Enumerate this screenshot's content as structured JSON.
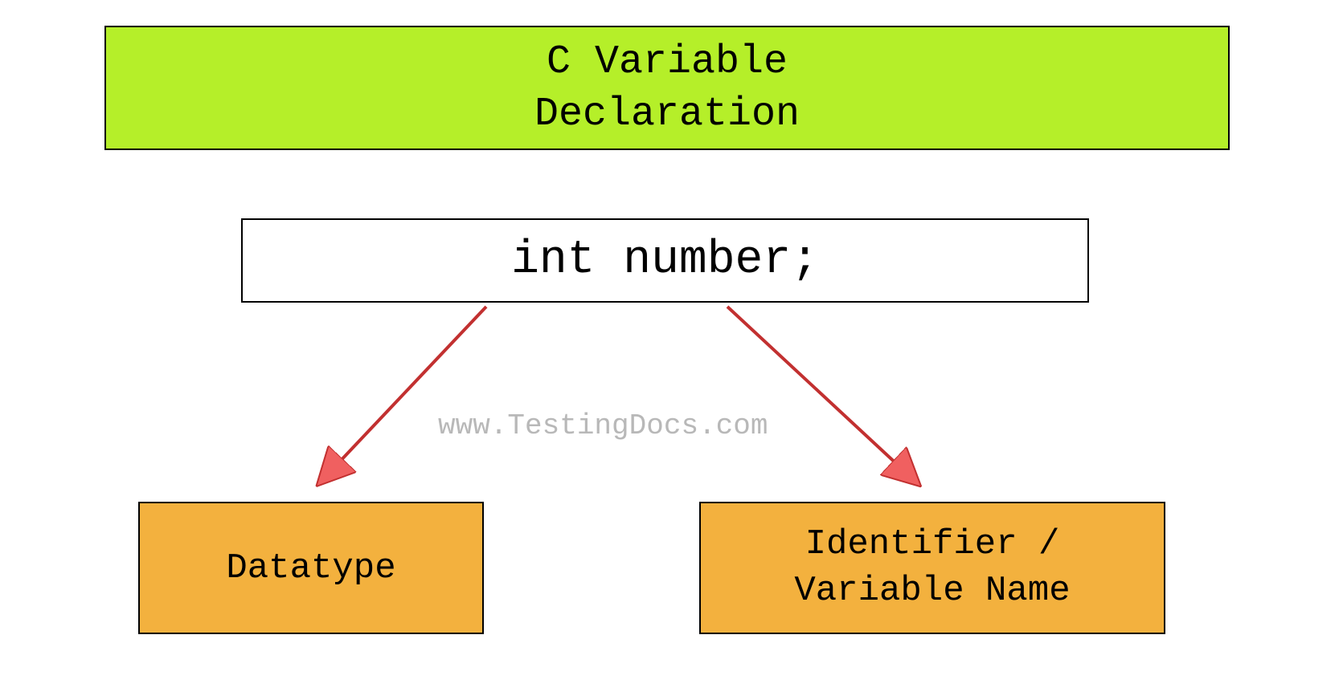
{
  "title": {
    "line1": "C Variable",
    "line2": "Declaration"
  },
  "code": "int number;",
  "watermark": "www.TestingDocs.com",
  "datatype": "Datatype",
  "identifier": {
    "line1": "Identifier /",
    "line2": "Variable Name"
  }
}
